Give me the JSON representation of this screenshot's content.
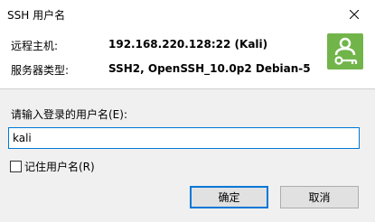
{
  "window": {
    "title": "SSH 用户名",
    "close_icon": "close-icon"
  },
  "info": {
    "remote_host_label": "远程主机:",
    "remote_host_value": "192.168.220.128:22 (Kali)",
    "server_type_label": "服务器类型:",
    "server_type_value": "SSH2, OpenSSH_10.0p2 Debian-5",
    "app_icon": "key-user-icon",
    "app_icon_color": "#71b54a"
  },
  "form": {
    "prompt": "请输入登录的用户名(E):",
    "username_value": "kali",
    "remember_label": "记住用户名(R)",
    "remember_checked": false
  },
  "buttons": {
    "ok_label": "确定",
    "cancel_label": "取消"
  },
  "colors": {
    "accent": "#0078d7",
    "form_background": "#f0f0f0"
  }
}
